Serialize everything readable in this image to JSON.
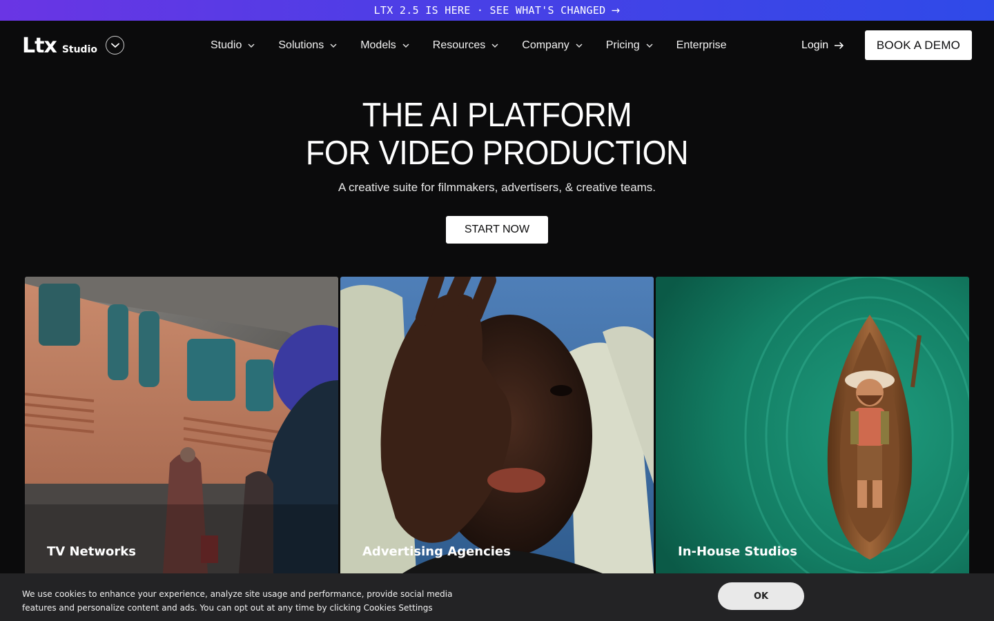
{
  "promo": {
    "text": "LTX 2.5 IS HERE · SEE WHAT'S CHANGED",
    "arrow": "→"
  },
  "brand": {
    "mark": "Ltx",
    "sub": "Studio"
  },
  "nav": {
    "items": [
      {
        "label": "Studio",
        "has_dropdown": true
      },
      {
        "label": "Solutions",
        "has_dropdown": true
      },
      {
        "label": "Models",
        "has_dropdown": true
      },
      {
        "label": "Resources",
        "has_dropdown": true
      },
      {
        "label": "Company",
        "has_dropdown": true
      },
      {
        "label": "Pricing",
        "has_dropdown": true
      },
      {
        "label": "Enterprise",
        "has_dropdown": false
      }
    ],
    "login_label": "Login",
    "demo_label": "BOOK A DEMO"
  },
  "hero": {
    "title_line1": "THE AI PLATFORM",
    "title_line2": "FOR VIDEO PRODUCTION",
    "subtitle": "A creative suite for filmmakers, advertisers, & creative teams.",
    "cta_label": "START NOW"
  },
  "cards": [
    {
      "label": "TV Networks",
      "image": "train-station-scene"
    },
    {
      "label": "Advertising Agencies",
      "image": "portrait-hand-over-face"
    },
    {
      "label": "In-House Studios",
      "image": "rowboat-character-on-water"
    }
  ],
  "cookie": {
    "line1": "We use cookies to enhance your experience, analyze site usage and performance, provide social media",
    "line2": "features and personalize content and ads. You can opt out at any time by clicking Cookies Settings",
    "ok_label": "OK"
  },
  "colors": {
    "background": "#0b0b0c",
    "promo_gradient_start": "#6a35e4",
    "promo_gradient_end": "#2f4ae8",
    "button_bg": "#ffffff",
    "cookie_bg": "#232325"
  }
}
